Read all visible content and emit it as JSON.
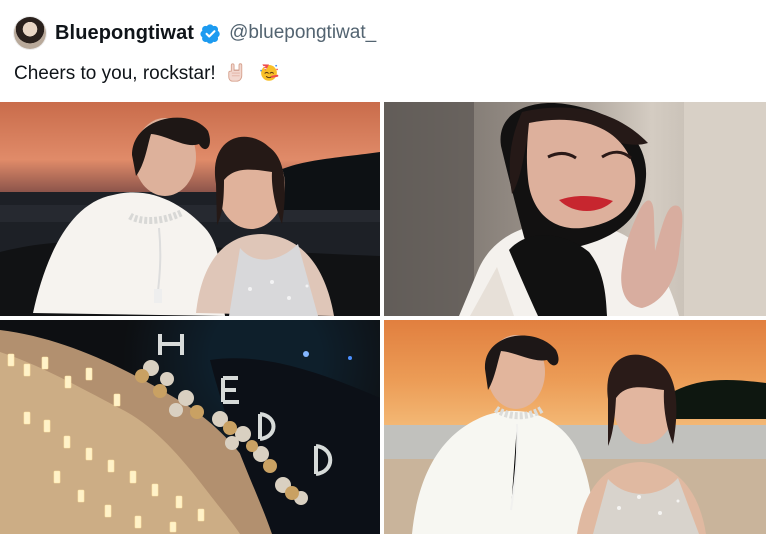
{
  "tweet": {
    "display_name": "Bluepongtiwat",
    "handle": "@bluepongtiwat_",
    "text": "Cheers to you, rockstar!",
    "emojis": [
      "rock-on-hand-emoji",
      "partying-face-emoji"
    ],
    "verified": true
  },
  "media": {
    "images": [
      {
        "name": "photo-beach-sunset-couple"
      },
      {
        "name": "photo-selfie-rock-hand"
      },
      {
        "name": "photo-candles-balloons"
      },
      {
        "name": "photo-beach-golden-hour-couple"
      }
    ]
  },
  "colors": {
    "verified_blue": "#1d9bf0",
    "secondary_text": "#536471",
    "primary_text": "#0f1419"
  }
}
